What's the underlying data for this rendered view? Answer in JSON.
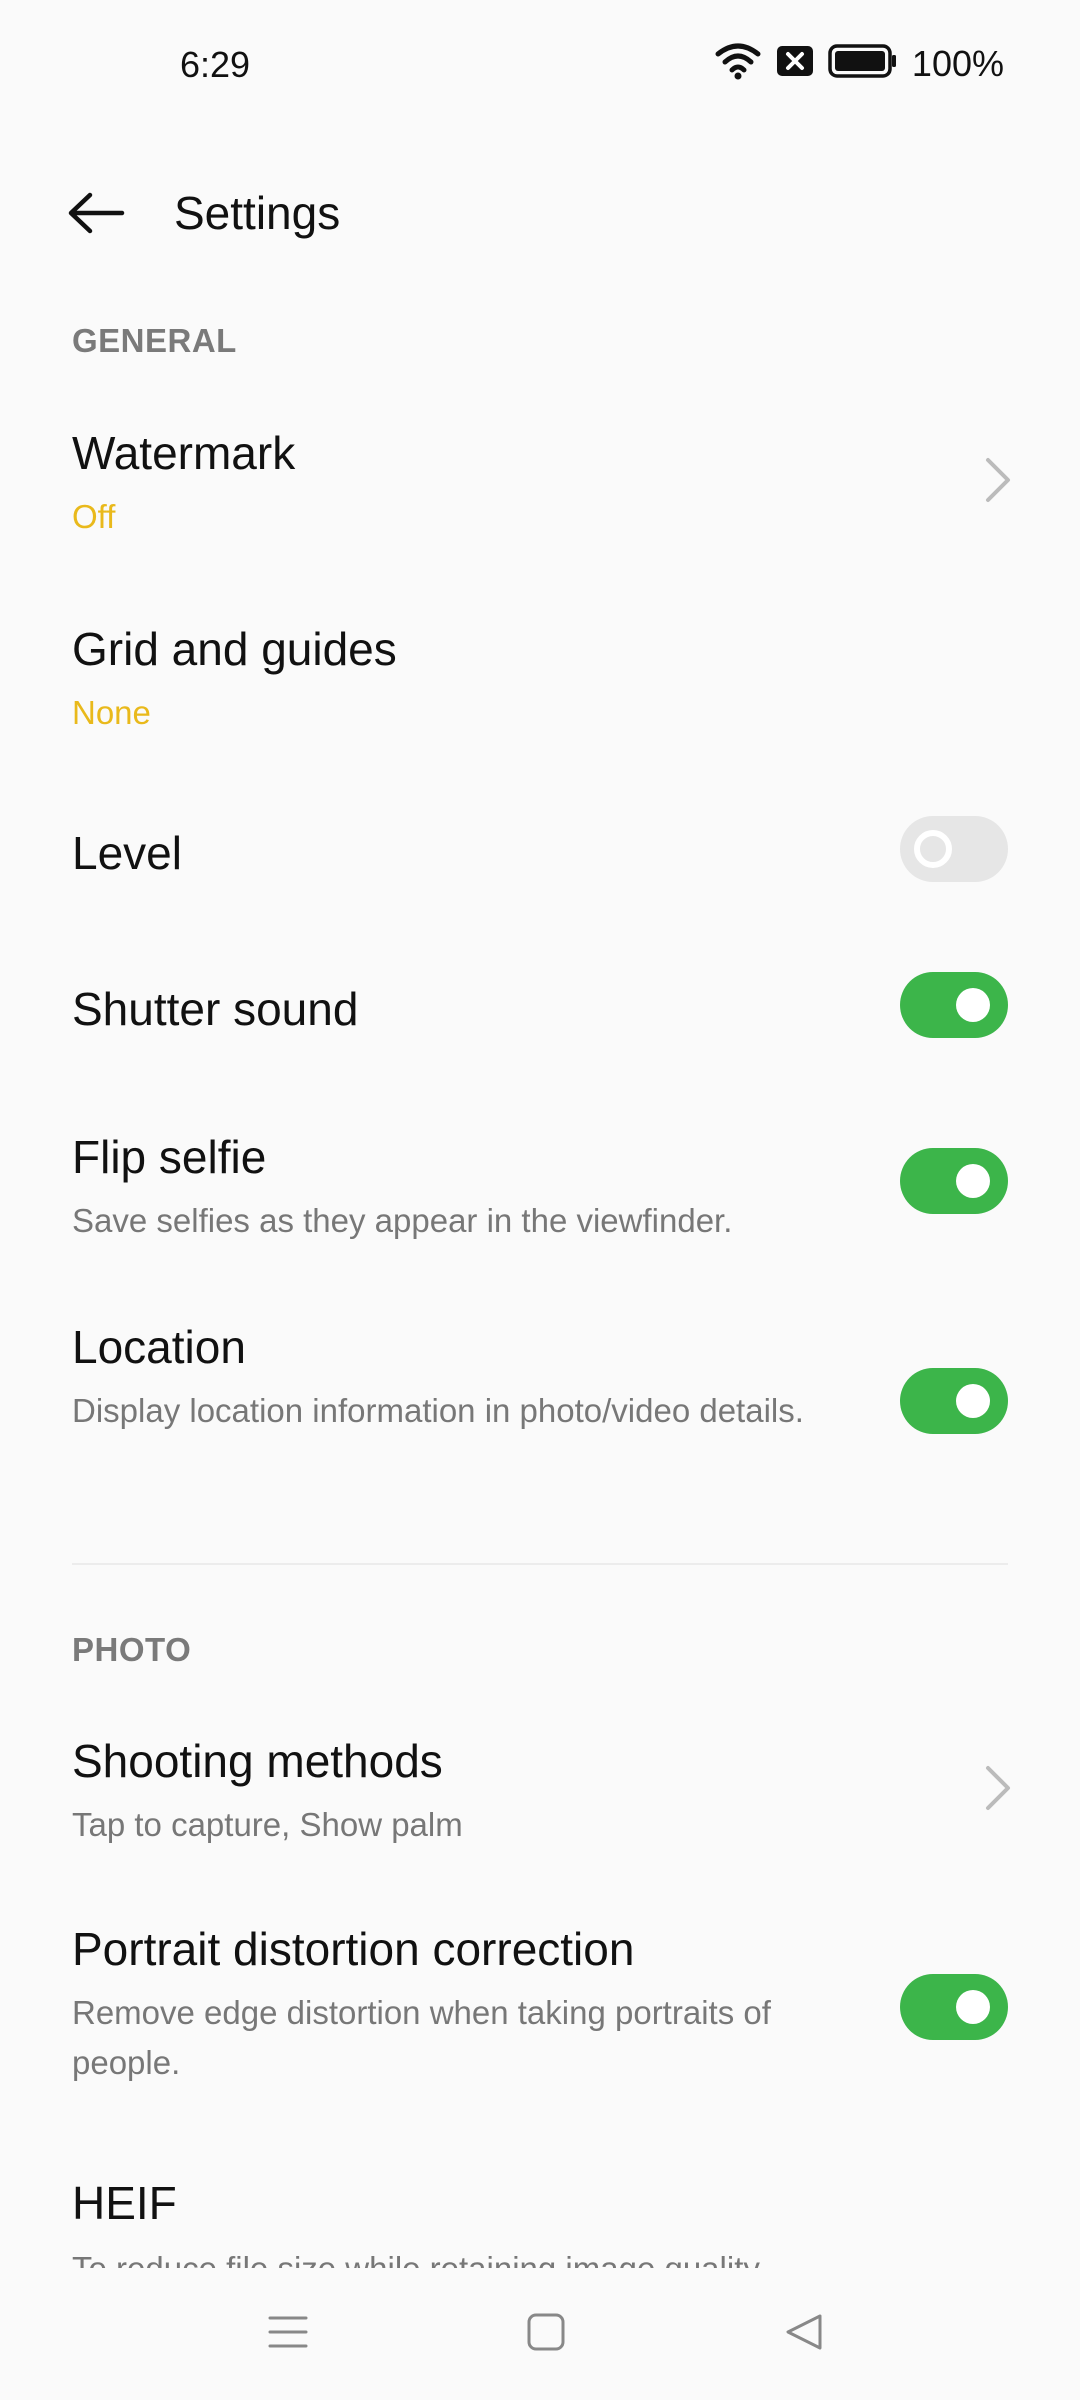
{
  "status_bar": {
    "time": "6:29",
    "battery_text": "100%",
    "icons": [
      "wifi-icon",
      "no-sim-icon",
      "battery-icon"
    ]
  },
  "app_bar": {
    "title": "Settings",
    "back_icon": "arrow-left-icon"
  },
  "colors": {
    "accent": "#e9b91b",
    "toggle_on": "#3cb54a",
    "toggle_off": "#e6e6e6",
    "section_header": "#7a7a7a",
    "subtitle": "#777777"
  },
  "sections": {
    "general": {
      "header": "GENERAL",
      "watermark": {
        "title": "Watermark",
        "value": "Off",
        "control": "chevron-right-icon"
      },
      "grid": {
        "title": "Grid and guides",
        "value": "None"
      },
      "level": {
        "title": "Level",
        "toggle": "off"
      },
      "shutter": {
        "title": "Shutter sound",
        "toggle": "on"
      },
      "flip": {
        "title": "Flip selfie",
        "subtitle": "Save selfies as they appear in the viewfinder.",
        "toggle": "on"
      },
      "location": {
        "title": "Location",
        "subtitle": "Display location information in photo/video details.",
        "toggle": "on"
      }
    },
    "photo": {
      "header": "PHOTO",
      "shooting": {
        "title": "Shooting methods",
        "subtitle": "Tap to capture, Show palm",
        "control": "chevron-right-icon"
      },
      "portrait": {
        "title": "Portrait distortion correction",
        "subtitle": "Remove edge distortion when taking portraits of people.",
        "toggle": "on"
      },
      "heif": {
        "title": "HEIF",
        "subtitle": "To reduce file size while retaining image quality,"
      }
    }
  },
  "nav_bar": {
    "buttons": [
      "menu-icon",
      "home-icon",
      "back-triangle-icon"
    ]
  }
}
